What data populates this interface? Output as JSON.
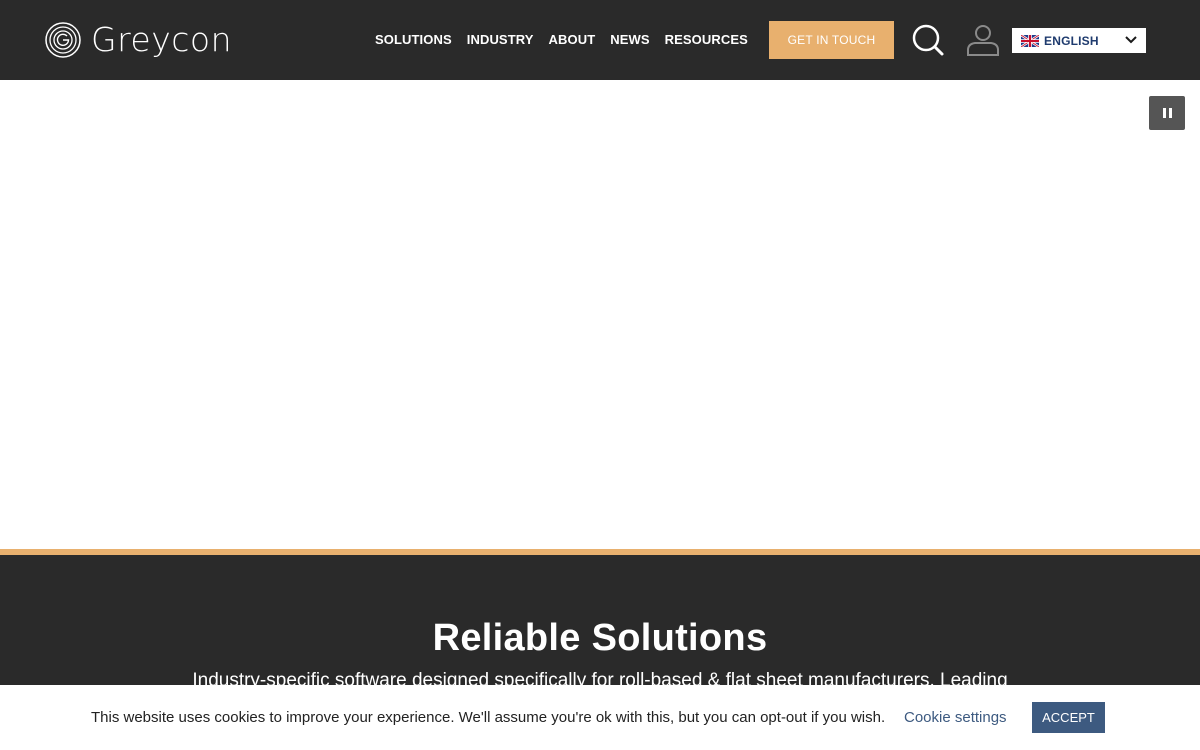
{
  "header": {
    "logo_text": "Greycon",
    "nav": [
      {
        "label": "SOLUTIONS"
      },
      {
        "label": "INDUSTRY"
      },
      {
        "label": "ABOUT"
      },
      {
        "label": "NEWS"
      },
      {
        "label": "RESOURCES"
      }
    ],
    "cta_label": "GET IN TOUCH",
    "language": {
      "selected": "ENGLISH",
      "flag": "uk-flag-icon"
    },
    "icons": {
      "search": "search-icon",
      "user": "user-icon"
    }
  },
  "hero": {
    "controls": {
      "pause": "pause-icon"
    }
  },
  "section": {
    "title": "Reliable Solutions",
    "subtitle": "Industry-specific software designed specifically for roll-based & flat sheet manufacturers. Leading"
  },
  "cookie_bar": {
    "message": "This website uses cookies to improve your experience. We'll assume you're ok with this, but you can opt-out if you wish.",
    "settings_label": "Cookie settings",
    "accept_label": "ACCEPT"
  },
  "colors": {
    "header_bg": "#2a2a2a",
    "accent": "#e8b06e",
    "button_blue": "#3d5a80",
    "lang_text": "#1f3b6e"
  }
}
